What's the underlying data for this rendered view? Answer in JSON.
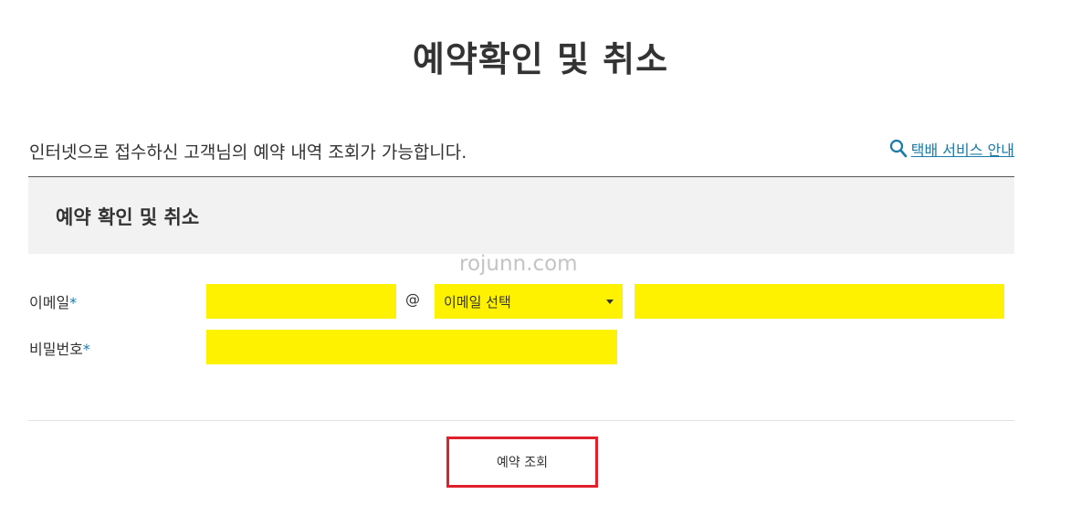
{
  "page": {
    "title": "예약확인 및 취소",
    "intro": "인터넷으로 접수하신 고객님의 예약 내역 조회가 가능합니다.",
    "guide_link": "택배 서비스 안내",
    "watermark": "rojunn.com"
  },
  "section": {
    "title": "예약 확인 및 취소"
  },
  "form": {
    "email_label": "이메일",
    "password_label": "비밀번호",
    "required_mark": "*",
    "at_sign": "@",
    "email_select": {
      "selected": "이메일 선택"
    },
    "email_id_value": "",
    "email_domain_value": "",
    "password_value": ""
  },
  "actions": {
    "submit_label": "예약 조회"
  },
  "colors": {
    "input_highlight": "#fff200",
    "highlight_border": "#e0202a",
    "link": "#1a7aa8"
  },
  "icons": {
    "guide_link_icon": "search-icon",
    "select_caret": "caret-down-icon"
  }
}
